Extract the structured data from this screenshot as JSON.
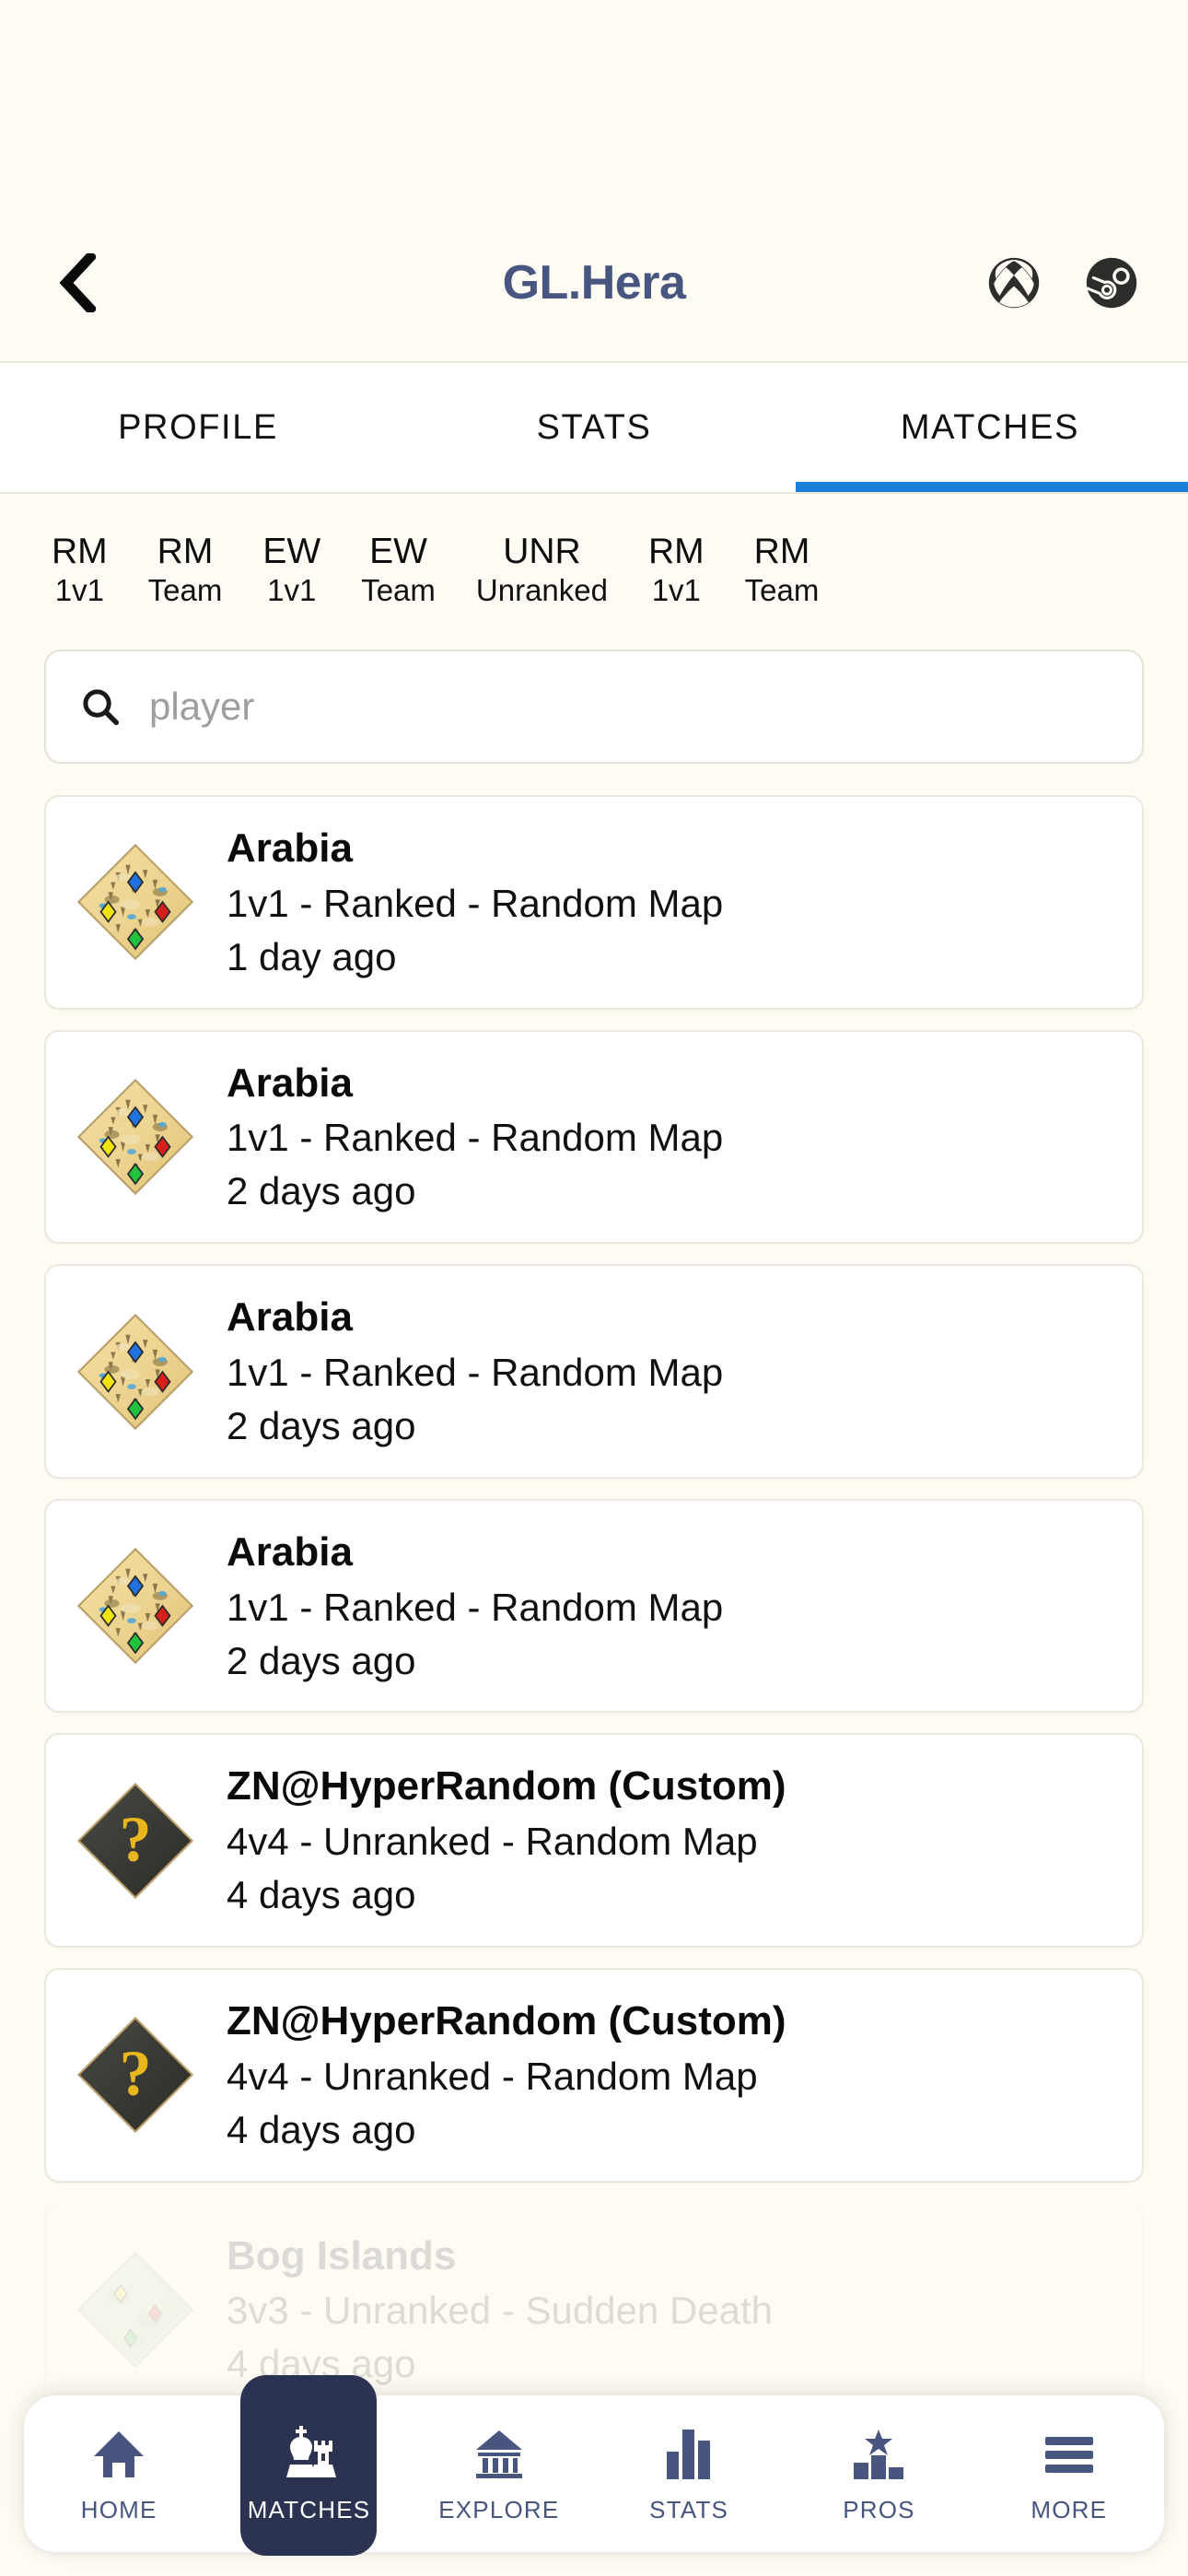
{
  "header": {
    "back_icon": "chevron-left-icon",
    "title": "GL.Hera",
    "platform_icons": [
      {
        "name": "xbox-icon",
        "label": "Xbox"
      },
      {
        "name": "steam-icon",
        "label": "Steam"
      }
    ]
  },
  "tabs": [
    {
      "label": "PROFILE",
      "active": false
    },
    {
      "label": "STATS",
      "active": false
    },
    {
      "label": "MATCHES",
      "active": true
    }
  ],
  "filters": [
    {
      "code": "RM",
      "sub": "1v1"
    },
    {
      "code": "RM",
      "sub": "Team"
    },
    {
      "code": "EW",
      "sub": "1v1"
    },
    {
      "code": "EW",
      "sub": "Team"
    },
    {
      "code": "UNR",
      "sub": "Unranked"
    },
    {
      "code": "RM",
      "sub": "1v1"
    },
    {
      "code": "RM",
      "sub": "Team"
    }
  ],
  "search": {
    "icon": "search-icon",
    "placeholder": "player",
    "value": ""
  },
  "matches": [
    {
      "map": "Arabia",
      "thumb": "arabia-map-thumbnail",
      "mode": "1v1 - Ranked - Random Map",
      "time": "1 day ago",
      "faded": false
    },
    {
      "map": "Arabia",
      "thumb": "arabia-map-thumbnail",
      "mode": "1v1 - Ranked - Random Map",
      "time": "2 days ago",
      "faded": false
    },
    {
      "map": "Arabia",
      "thumb": "arabia-map-thumbnail",
      "mode": "1v1 - Ranked - Random Map",
      "time": "2 days ago",
      "faded": false
    },
    {
      "map": "Arabia",
      "thumb": "arabia-map-thumbnail",
      "mode": "1v1 - Ranked - Random Map",
      "time": "2 days ago",
      "faded": false
    },
    {
      "map": "ZN@HyperRandom (Custom)",
      "thumb": "unknown-map-thumbnail",
      "mode": "4v4 - Unranked - Random Map",
      "time": "4 days ago",
      "faded": false
    },
    {
      "map": "ZN@HyperRandom (Custom)",
      "thumb": "unknown-map-thumbnail",
      "mode": "4v4 - Unranked - Random Map",
      "time": "4 days ago",
      "faded": false
    },
    {
      "map": "Bog Islands",
      "thumb": "bog-islands-map-thumbnail",
      "mode": "3v3 - Unranked - Sudden Death",
      "time": "4 days ago",
      "faded": true
    }
  ],
  "bottom_nav": [
    {
      "label": "HOME",
      "icon": "home-icon",
      "active": false
    },
    {
      "label": "MATCHES",
      "icon": "chess-icon",
      "active": true
    },
    {
      "label": "EXPLORE",
      "icon": "temple-icon",
      "active": false
    },
    {
      "label": "STATS",
      "icon": "bar-chart-icon",
      "active": false
    },
    {
      "label": "PROS",
      "icon": "podium-star-icon",
      "active": false
    },
    {
      "label": "MORE",
      "icon": "hamburger-icon",
      "active": false
    }
  ],
  "colors": {
    "background": "#fdfbf3",
    "card": "#ffffff",
    "accent_blue": "#1a80d8",
    "navy": "#47557f",
    "nav_active": "#2b3350"
  }
}
